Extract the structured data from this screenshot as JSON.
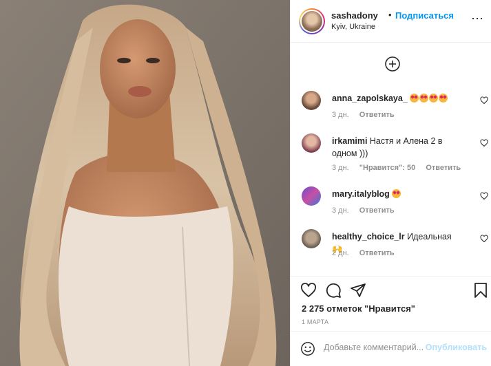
{
  "post": {
    "username": "sashadony",
    "follow_label": "Подписаться",
    "separator": "•",
    "location": "Kyiv, Ukraine",
    "more_icon": "⋯"
  },
  "comments": [
    {
      "user": "anna_zapolskaya_",
      "text": "",
      "emoji_count": 4,
      "time": "3 дн.",
      "likes": "",
      "reply": "Ответить"
    },
    {
      "user": "irkamimi",
      "text": "Настя и Алена 2 в одном )))",
      "emoji_count": 0,
      "time": "3 дн.",
      "likes": "\"Нравится\": 50",
      "reply": "Ответить"
    },
    {
      "user": "mary.italyblog",
      "text": "",
      "emoji_count": 1,
      "time": "3 дн.",
      "likes": "",
      "reply": "Ответить"
    },
    {
      "user": "healthy_choice_lr",
      "text": "Идеальная 🙌",
      "emoji_count": 0,
      "time": "2 дн.",
      "likes": "",
      "reply": "Ответить"
    }
  ],
  "actions": {
    "likes_count": "2 275 отметок \"Нравится\"",
    "date": "1 МАРТА",
    "comment_placeholder": "Добавьте комментарий...",
    "publish_label": "Опубликовать"
  },
  "colors": {
    "link_blue": "#0095f6",
    "publish_disabled": "#b2dffc",
    "muted": "#8e8e8e",
    "text": "#262626"
  }
}
